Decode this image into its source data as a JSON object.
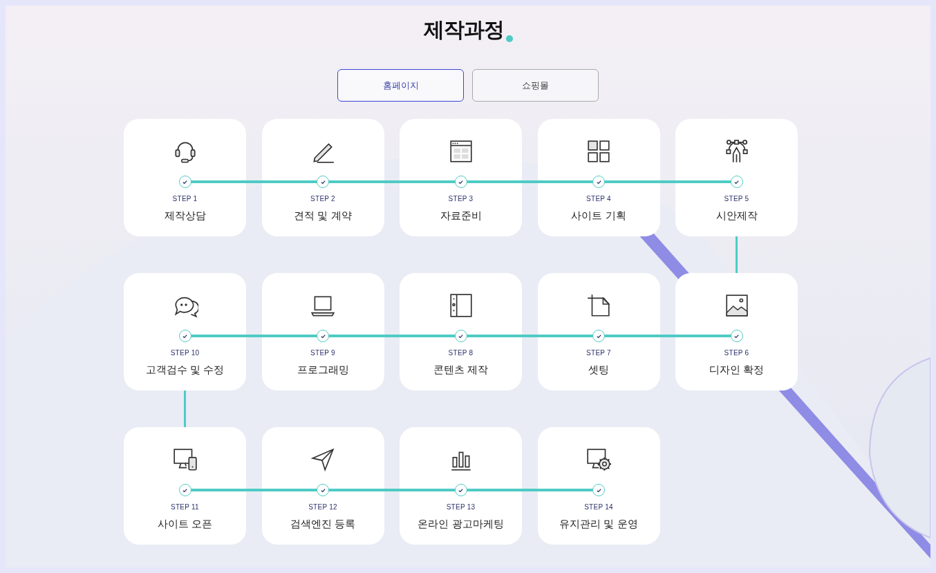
{
  "title": "제작과정",
  "tabs": [
    {
      "label": "홈페이지",
      "selected": true
    },
    {
      "label": "쇼핑몰",
      "selected": false
    }
  ],
  "rows": [
    {
      "steps": [
        {
          "step": "STEP 1",
          "label": "제작상담"
        },
        {
          "step": "STEP 2",
          "label": "견적 및 계약"
        },
        {
          "step": "STEP 3",
          "label": "자료준비"
        },
        {
          "step": "STEP 4",
          "label": "사이트 기획"
        },
        {
          "step": "STEP 5",
          "label": "시안제작"
        }
      ]
    },
    {
      "steps": [
        {
          "step": "STEP 10",
          "label": "고객검수 및 수정"
        },
        {
          "step": "STEP 9",
          "label": "프로그래밍"
        },
        {
          "step": "STEP 8",
          "label": "콘텐츠 제작"
        },
        {
          "step": "STEP 7",
          "label": "셋팅"
        },
        {
          "step": "STEP 6",
          "label": "디자인 확정"
        }
      ]
    },
    {
      "steps": [
        {
          "step": "STEP 11",
          "label": "사이트 오픈"
        },
        {
          "step": "STEP 12",
          "label": "검색엔진 등록"
        },
        {
          "step": "STEP 13",
          "label": "온라인 광고마케팅"
        },
        {
          "step": "STEP 14",
          "label": "유지관리 및 운영"
        }
      ]
    }
  ]
}
